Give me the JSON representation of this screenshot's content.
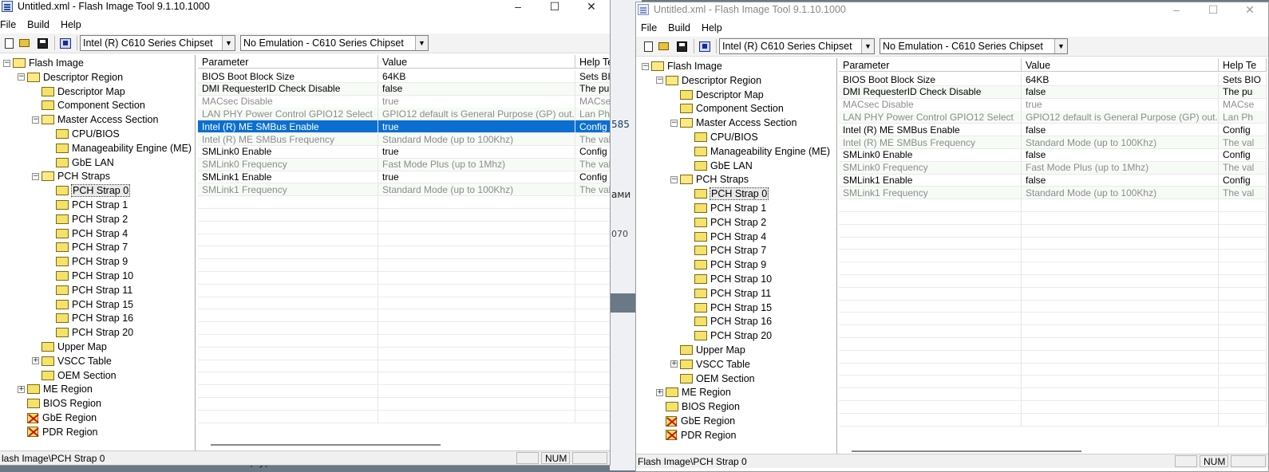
{
  "background": {
    "fragments": [
      "585",
      "ами",
      "070",
      "Nitrum-Mean(uy)."
    ]
  },
  "left_window": {
    "title": "Untitled.xml - Flash Image Tool 9.1.10.1000",
    "menu": [
      "File",
      "Build",
      "Help"
    ],
    "chipset": "Intel (R) C610 Series Chipset",
    "emulation": "No Emulation - C610 Series Chipset",
    "grid": {
      "headers": [
        "Parameter",
        "Value",
        "Help Te"
      ],
      "rows": [
        {
          "param": "BIOS Boot Block Size",
          "value": "64KB",
          "help": "Sets BIO"
        },
        {
          "param": "DMI RequesterID Check Disable",
          "value": "false",
          "help": "The pu"
        },
        {
          "param": "MACsec Disable",
          "value": "true",
          "help": "MACse"
        },
        {
          "param": "LAN PHY Power Control GPIO12 Select",
          "value": "GPIO12 default is General Purpose (GP) out...",
          "help": "Lan Ph"
        },
        {
          "param": "Intel (R) ME SMBus Enable",
          "value": "true",
          "help": "Config"
        },
        {
          "param": "Intel (R) ME SMBus Frequency",
          "value": "Standard Mode (up to 100Khz)",
          "help": "The val"
        },
        {
          "param": "SMLink0 Enable",
          "value": "true",
          "help": "Config"
        },
        {
          "param": "SMLink0 Frequency",
          "value": "Fast Mode Plus (up to 1Mhz)",
          "help": "The val"
        },
        {
          "param": "SMLink1 Enable",
          "value": "true",
          "help": "Config"
        },
        {
          "param": "SMLink1 Frequency",
          "value": "Standard Mode (up to 100Khz)",
          "help": "The val"
        }
      ]
    },
    "status": "lash Image\\PCH Strap 0",
    "num": "NUM"
  },
  "right_window": {
    "title": "Untitled.xml - Flash Image Tool 9.1.10.1000",
    "menu": [
      "File",
      "Build",
      "Help"
    ],
    "chipset": "Intel (R) C610 Series Chipset",
    "emulation": "No Emulation - C610 Series Chipset",
    "grid": {
      "headers": [
        "Parameter",
        "Value",
        "Help Te"
      ],
      "rows": [
        {
          "param": "BIOS Boot Block Size",
          "value": "64KB",
          "help": "Sets BIO"
        },
        {
          "param": "DMI RequesterID Check Disable",
          "value": "false",
          "help": "The pu"
        },
        {
          "param": "MACsec Disable",
          "value": "true",
          "help": "MACse"
        },
        {
          "param": "LAN PHY Power Control GPIO12 Select",
          "value": "GPIO12 default is General Purpose (GP) out...",
          "help": "Lan Ph"
        },
        {
          "param": "Intel (R) ME SMBus Enable",
          "value": "false",
          "help": "Config"
        },
        {
          "param": "Intel (R) ME SMBus Frequency",
          "value": "Standard Mode (up to 100Khz)",
          "help": "The val"
        },
        {
          "param": "SMLink0 Enable",
          "value": "false",
          "help": "Config"
        },
        {
          "param": "SMLink0 Frequency",
          "value": "Fast Mode Plus (up to 1Mhz)",
          "help": "The val"
        },
        {
          "param": "SMLink1 Enable",
          "value": "false",
          "help": "Config"
        },
        {
          "param": "SMLink1 Frequency",
          "value": "Standard Mode (up to 100Khz)",
          "help": "The val"
        }
      ]
    },
    "status": "Flash Image\\PCH Strap 0",
    "num": "NUM"
  },
  "tree": [
    {
      "label": "Flash Image",
      "level": 0,
      "expander": "minus",
      "icon": "folder-open"
    },
    {
      "label": "Descriptor Region",
      "level": 1,
      "expander": "minus",
      "icon": "folder-open"
    },
    {
      "label": "Descriptor Map",
      "level": 2,
      "icon": "folder"
    },
    {
      "label": "Component Section",
      "level": 2,
      "icon": "folder"
    },
    {
      "label": "Master Access Section",
      "level": 2,
      "expander": "minus",
      "icon": "folder-open"
    },
    {
      "label": "CPU/BIOS",
      "level": 3,
      "icon": "folder"
    },
    {
      "label": "Manageability Engine (ME)",
      "level": 3,
      "icon": "folder"
    },
    {
      "label": "GbE LAN",
      "level": 3,
      "icon": "folder"
    },
    {
      "label": "PCH Straps",
      "level": 2,
      "expander": "minus",
      "icon": "folder-open"
    },
    {
      "label": "PCH Strap 0",
      "level": 3,
      "icon": "folder",
      "selected": true
    },
    {
      "label": "PCH Strap 1",
      "level": 3,
      "icon": "folder"
    },
    {
      "label": "PCH Strap 2",
      "level": 3,
      "icon": "folder"
    },
    {
      "label": "PCH Strap 4",
      "level": 3,
      "icon": "folder"
    },
    {
      "label": "PCH Strap 7",
      "level": 3,
      "icon": "folder"
    },
    {
      "label": "PCH Strap 9",
      "level": 3,
      "icon": "folder"
    },
    {
      "label": "PCH Strap 10",
      "level": 3,
      "icon": "folder"
    },
    {
      "label": "PCH Strap 11",
      "level": 3,
      "icon": "folder"
    },
    {
      "label": "PCH Strap 15",
      "level": 3,
      "icon": "folder"
    },
    {
      "label": "PCH Strap 16",
      "level": 3,
      "icon": "folder"
    },
    {
      "label": "PCH Strap 20",
      "level": 3,
      "icon": "folder"
    },
    {
      "label": "Upper Map",
      "level": 2,
      "icon": "folder"
    },
    {
      "label": "VSCC Table",
      "level": 2,
      "expander": "plus",
      "icon": "folder"
    },
    {
      "label": "OEM Section",
      "level": 2,
      "icon": "folder"
    },
    {
      "label": "ME Region",
      "level": 1,
      "expander": "plus",
      "icon": "folder"
    },
    {
      "label": "BIOS Region",
      "level": 1,
      "icon": "folder"
    },
    {
      "label": "GbE Region",
      "level": 1,
      "icon": "folder-disabled"
    },
    {
      "label": "PDR Region",
      "level": 1,
      "icon": "folder-disabled"
    }
  ],
  "dim_rows": [
    2,
    3,
    5,
    7,
    9
  ],
  "left_highlight_row": 4
}
